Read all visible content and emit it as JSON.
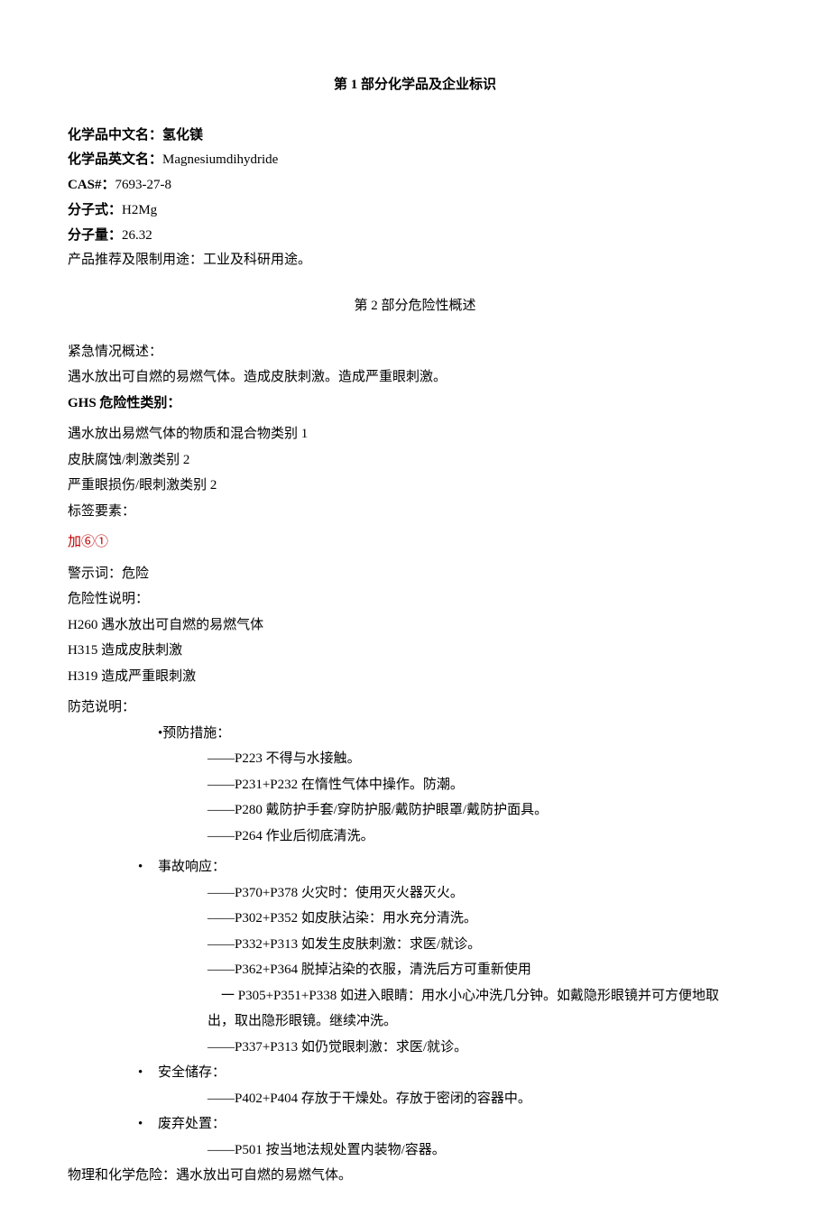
{
  "section1": {
    "title": "第 1 部分化学品及企业标识",
    "fields": {
      "cn_name_label": "化学品中文名：",
      "cn_name_value": "氢化镁",
      "en_name_label": "化学品英文名：",
      "en_name_value": "Magnesiumdihydride",
      "cas_label": "CAS#：",
      "cas_value": "7693-27-8",
      "formula_label": "分子式：",
      "formula_value": "H2Mg",
      "mw_label": "分子量：",
      "mw_value": "26.32",
      "use_label": "产品推荐及限制用途：",
      "use_value": "工业及科研用途。"
    }
  },
  "section2": {
    "title": "第 2 部分危险性概述",
    "emergency_label": "紧急情况概述：",
    "emergency_text": "遇水放出可自燃的易燃气体。造成皮肤刺激。造成严重眼刺激。",
    "ghs_label": "GHS 危险性类别：",
    "ghs_items": [
      "遇水放出易燃气体的物质和混合物类别 1",
      "皮肤腐蚀/刺激类别 2",
      "严重眼损伤/眼刺激类别 2"
    ],
    "label_elements": "标签要素：",
    "pictograms": "加⑥①",
    "signal_label": "警示词：",
    "signal_value": "危险",
    "hazard_statement_label": "危险性说明：",
    "hazard_statements": [
      "H260 遇水放出可自燃的易燃气体",
      "H315 造成皮肤刺激",
      "H319 造成严重眼刺激"
    ],
    "precaution_label": "防范说明：",
    "prevention": {
      "header": "•预防措施：",
      "items": [
        "——P223 不得与水接触。",
        "——P231+P232 在惰性气体中操作。防潮。",
        "——P280 戴防护手套/穿防护服/戴防护眼罩/戴防护面具。",
        "——P264 作业后彻底清洗。"
      ]
    },
    "response": {
      "bullet": "•",
      "header": "事故响应：",
      "items": [
        "——P370+P378 火灾时：使用灭火器灭火。",
        "——P302+P352 如皮肤沾染：用水充分清洗。",
        "——P332+P313 如发生皮肤刺激：求医/就诊。",
        "——P362+P364 脱掉沾染的衣服，清洗后方可重新使用"
      ],
      "special_line1": "　一 P305+P351+P338 如进入眼睛：用水小心冲洗几分钟。如戴隐形眼镜并可方便地取",
      "special_line2": "出，取出隐形眼镜。继续冲洗。",
      "last_item": "——P337+P313 如仍觉眼刺激：求医/就诊。"
    },
    "storage": {
      "bullet": "•",
      "header": "安全储存：",
      "items": [
        "——P402+P404 存放于干燥处。存放于密闭的容器中。"
      ]
    },
    "disposal": {
      "bullet": "•",
      "header": "废弃处置：",
      "items": [
        "——P501 按当地法规处置内装物/容器。"
      ]
    },
    "phys_chem_label": "物理和化学危险：",
    "phys_chem_value": "遇水放出可自燃的易燃气体。"
  }
}
